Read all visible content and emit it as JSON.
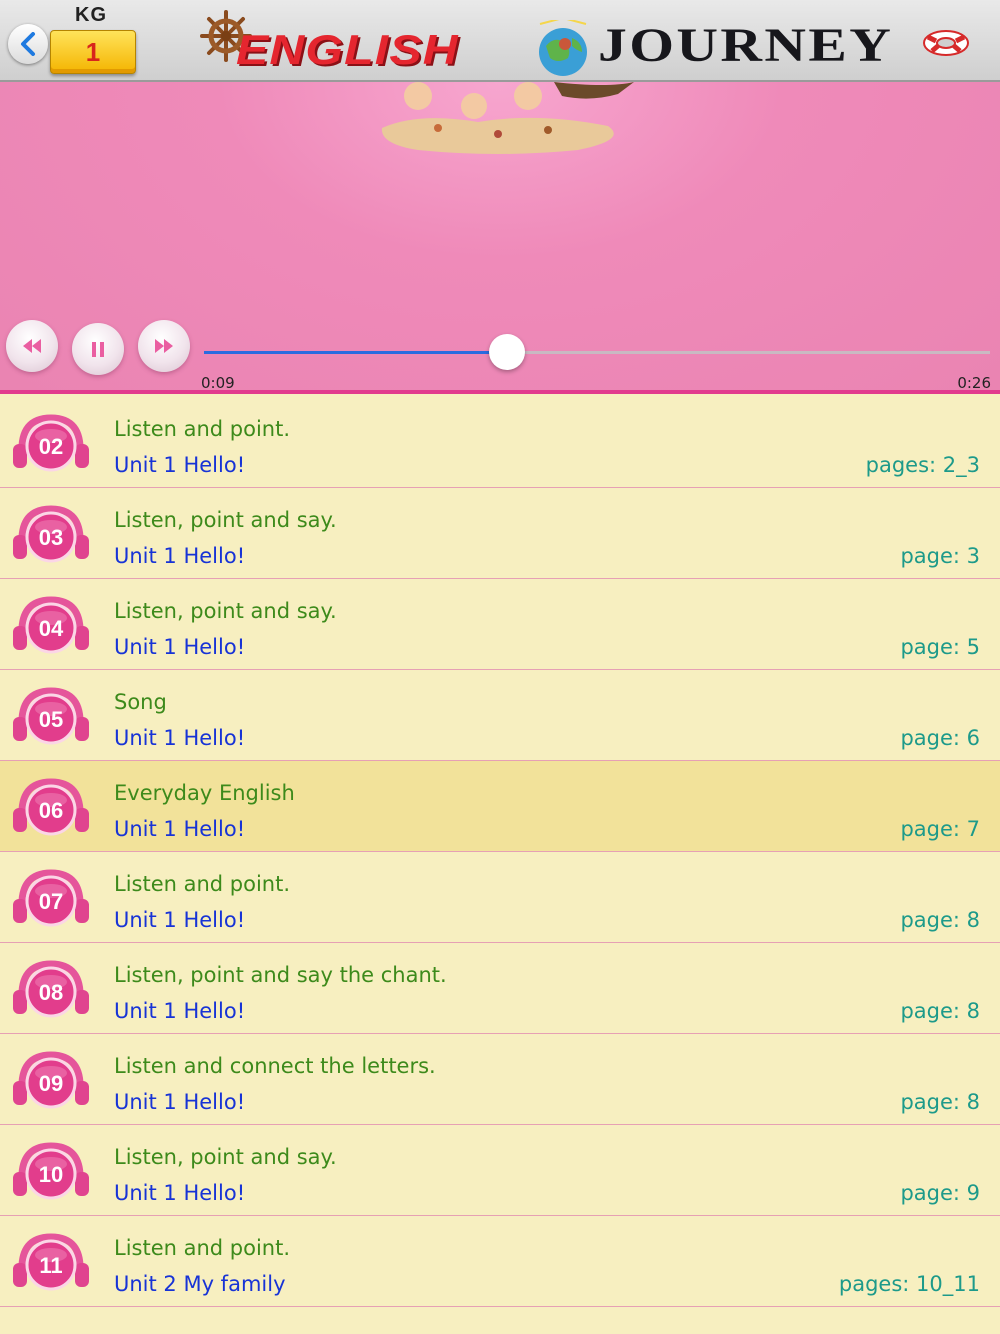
{
  "header": {
    "level_caption": "KG",
    "level_value": "1",
    "logo_text_part1": "English",
    "logo_text_part2": "Journey",
    "logo_display_part1": "ENGLISH",
    "logo_display_part2": "JOURNEY"
  },
  "player": {
    "elapsed": "0:09",
    "total": "0:26",
    "progress_fraction": 0.385
  },
  "tracks": [
    {
      "number": "02",
      "title": "Listen and point.",
      "unit": "Unit 1 Hello!",
      "pages": "pages: 2_3",
      "selected": false
    },
    {
      "number": "03",
      "title": "Listen, point and say.",
      "unit": "Unit 1 Hello!",
      "pages": "page: 3",
      "selected": false
    },
    {
      "number": "04",
      "title": "Listen, point and say.",
      "unit": "Unit 1 Hello!",
      "pages": "page: 5",
      "selected": false
    },
    {
      "number": "05",
      "title": "Song",
      "unit": "Unit 1 Hello!",
      "pages": "page: 6",
      "selected": false
    },
    {
      "number": "06",
      "title": "Everyday English",
      "unit": "Unit 1 Hello!",
      "pages": "page: 7",
      "selected": true
    },
    {
      "number": "07",
      "title": "Listen and point.",
      "unit": "Unit 1 Hello!",
      "pages": "page: 8",
      "selected": false
    },
    {
      "number": "08",
      "title": "Listen, point and say the chant.",
      "unit": "Unit 1 Hello!",
      "pages": "page: 8",
      "selected": false
    },
    {
      "number": "09",
      "title": "Listen and connect the letters.",
      "unit": "Unit 1 Hello!",
      "pages": "page: 8",
      "selected": false
    },
    {
      "number": "10",
      "title": "Listen, point and say.",
      "unit": "Unit 1 Hello!",
      "pages": "page: 9",
      "selected": false
    },
    {
      "number": "11",
      "title": "Listen and point.",
      "unit": "Unit 2 My family",
      "pages": "pages: 10_11",
      "selected": false
    }
  ],
  "colors": {
    "accent_pink": "#e23b8d",
    "title_green": "#3d8a1b",
    "unit_blue": "#1733d6",
    "pages_teal": "#1d9a8a",
    "list_bg": "#f7efc0",
    "selected_bg": "#f2e29a"
  },
  "icons": {
    "back": "chevron-left-icon",
    "rewind": "rewind-icon",
    "pause": "pause-icon",
    "forward": "fast-forward-icon",
    "track_badge": "headphones-icon"
  }
}
